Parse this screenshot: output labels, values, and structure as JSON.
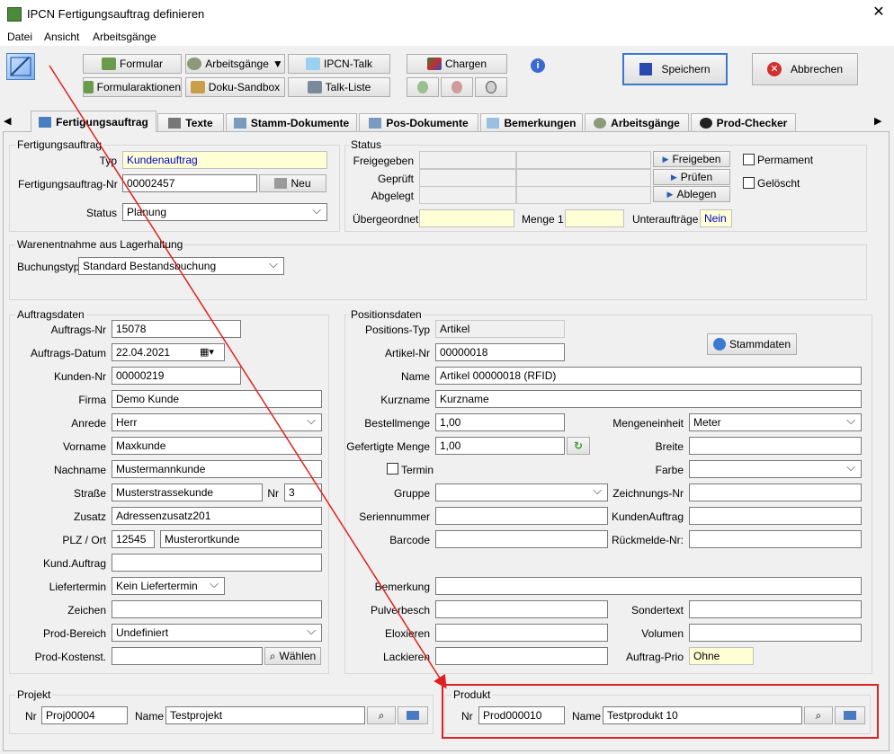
{
  "window": {
    "title": "IPCN Fertigungsauftrag definieren",
    "close": "✕"
  },
  "menu": [
    "Datei",
    "Ansicht",
    "Arbeitsgänge"
  ],
  "toolbar": {
    "formular": "Formular",
    "formularaktionen": "Formularaktionen",
    "arbeitsgaenge": "Arbeitsgänge",
    "doku_sandbox": "Doku-Sandbox",
    "ipcn_talk": "IPCN-Talk",
    "talk_liste": "Talk-Liste",
    "chargen": "Chargen",
    "speichern": "Speichern",
    "abbrechen": "Abbrechen",
    "info": "i"
  },
  "tabs": [
    "Fertigungsauftrag",
    "Texte",
    "Stamm-Dokumente",
    "Pos-Dokumente",
    "Bemerkungen",
    "Arbeitsgänge",
    "Prod-Checker"
  ],
  "fa": {
    "group": "Fertigungsauftrag",
    "typ_label": "Typ",
    "typ": "Kundenauftrag",
    "nr_label": "Fertigungsauftrag-Nr",
    "nr": "00002457",
    "neu": "Neu",
    "status_label": "Status",
    "status": "Planung"
  },
  "status": {
    "group": "Status",
    "freigegeben": "Freigegeben",
    "geprueft": "Geprüft",
    "abgelegt": "Abgelegt",
    "btn_freigeben": "Freigeben",
    "btn_pruefen": "Prüfen",
    "btn_ablegen": "Ablegen",
    "permanent": "Permament",
    "geloescht": "Gelöscht",
    "uebergeordnet": "Übergeordnet",
    "menge_label": "Menge 1",
    "unterauftraege": "Unteraufträge",
    "unterauftraege_val": "Nein"
  },
  "waren": {
    "group": "Warenentnahme aus Lagerhaltung",
    "buchungstyp_label": "Buchungstyp",
    "buchungstyp": "Standard Bestandsbuchung"
  },
  "auftrag": {
    "group": "Auftragsdaten",
    "auftrags_nr_label": "Auftrags-Nr",
    "auftrags_nr": "15078",
    "datum_label": "Auftrags-Datum",
    "datum": "22.04.2021",
    "kunden_nr_label": "Kunden-Nr",
    "kunden_nr": "00000219",
    "firma_label": "Firma",
    "firma": "Demo Kunde",
    "anrede_label": "Anrede",
    "anrede": "Herr",
    "vorname_label": "Vorname",
    "vorname": "Maxkunde",
    "nachname_label": "Nachname",
    "nachname": "Mustermannkunde",
    "strasse_label": "Straße",
    "strasse": "Musterstrassekunde",
    "nr_label": "Nr",
    "nr": "3",
    "zusatz_label": "Zusatz",
    "zusatz": "Adressenzusatz201",
    "plz_label": "PLZ / Ort",
    "plz": "12545",
    "ort": "Musterortkunde",
    "kund_auftrag_label": "Kund.Auftrag",
    "liefertermin_label": "Liefertermin",
    "liefertermin": "Kein Liefertermin",
    "zeichen_label": "Zeichen",
    "prod_bereich_label": "Prod-Bereich",
    "prod_bereich": "Undefiniert",
    "prod_kostenst_label": "Prod-Kostenst.",
    "waehlen": "Wählen"
  },
  "pos": {
    "group": "Positionsdaten",
    "typ_label": "Positions-Typ",
    "typ": "Artikel",
    "stammdaten": "Stammdaten",
    "artikel_nr_label": "Artikel-Nr",
    "artikel_nr": "00000018",
    "name_label": "Name",
    "name": "Artikel 00000018  (RFID)",
    "kurzname_label": "Kurzname",
    "kurzname": "Kurzname",
    "bestellmenge_label": "Bestellmenge",
    "bestellmenge": "1,00",
    "mengeneinheit_label": "Mengeneinheit",
    "mengeneinheit": "Meter",
    "gefertigt_label": "Gefertigte Menge",
    "gefertigt": "1,00",
    "breite_label": "Breite",
    "termin_label": "Termin",
    "farbe_label": "Farbe",
    "gruppe_label": "Gruppe",
    "zeichnungs_label": "Zeichnungs-Nr",
    "serien_label": "Seriennummer",
    "kundenauftrag_label": "KundenAuftrag",
    "barcode_label": "Barcode",
    "rueckmelde_label": "Rückmelde-Nr:",
    "bemerkung_label": "Bemerkung",
    "pulver_label": "Pulverbesch",
    "sondertext_label": "Sondertext",
    "eloxieren_label": "Eloxieren",
    "volumen_label": "Volumen",
    "lackieren_label": "Lackieren",
    "prio_label": "Auftrag-Prio",
    "prio": "Ohne"
  },
  "projekt": {
    "group": "Projekt",
    "nr_label": "Nr",
    "nr": "Proj00004",
    "name_label": "Name",
    "name": "Testprojekt"
  },
  "produkt": {
    "group": "Produkt",
    "nr_label": "Nr",
    "nr": "Prod000010",
    "name_label": "Name",
    "name": "Testprodukt 10"
  },
  "colors": {
    "accent": "#1a5fb4",
    "highlight": "#e02020",
    "yellow_field": "#ffffd6"
  }
}
